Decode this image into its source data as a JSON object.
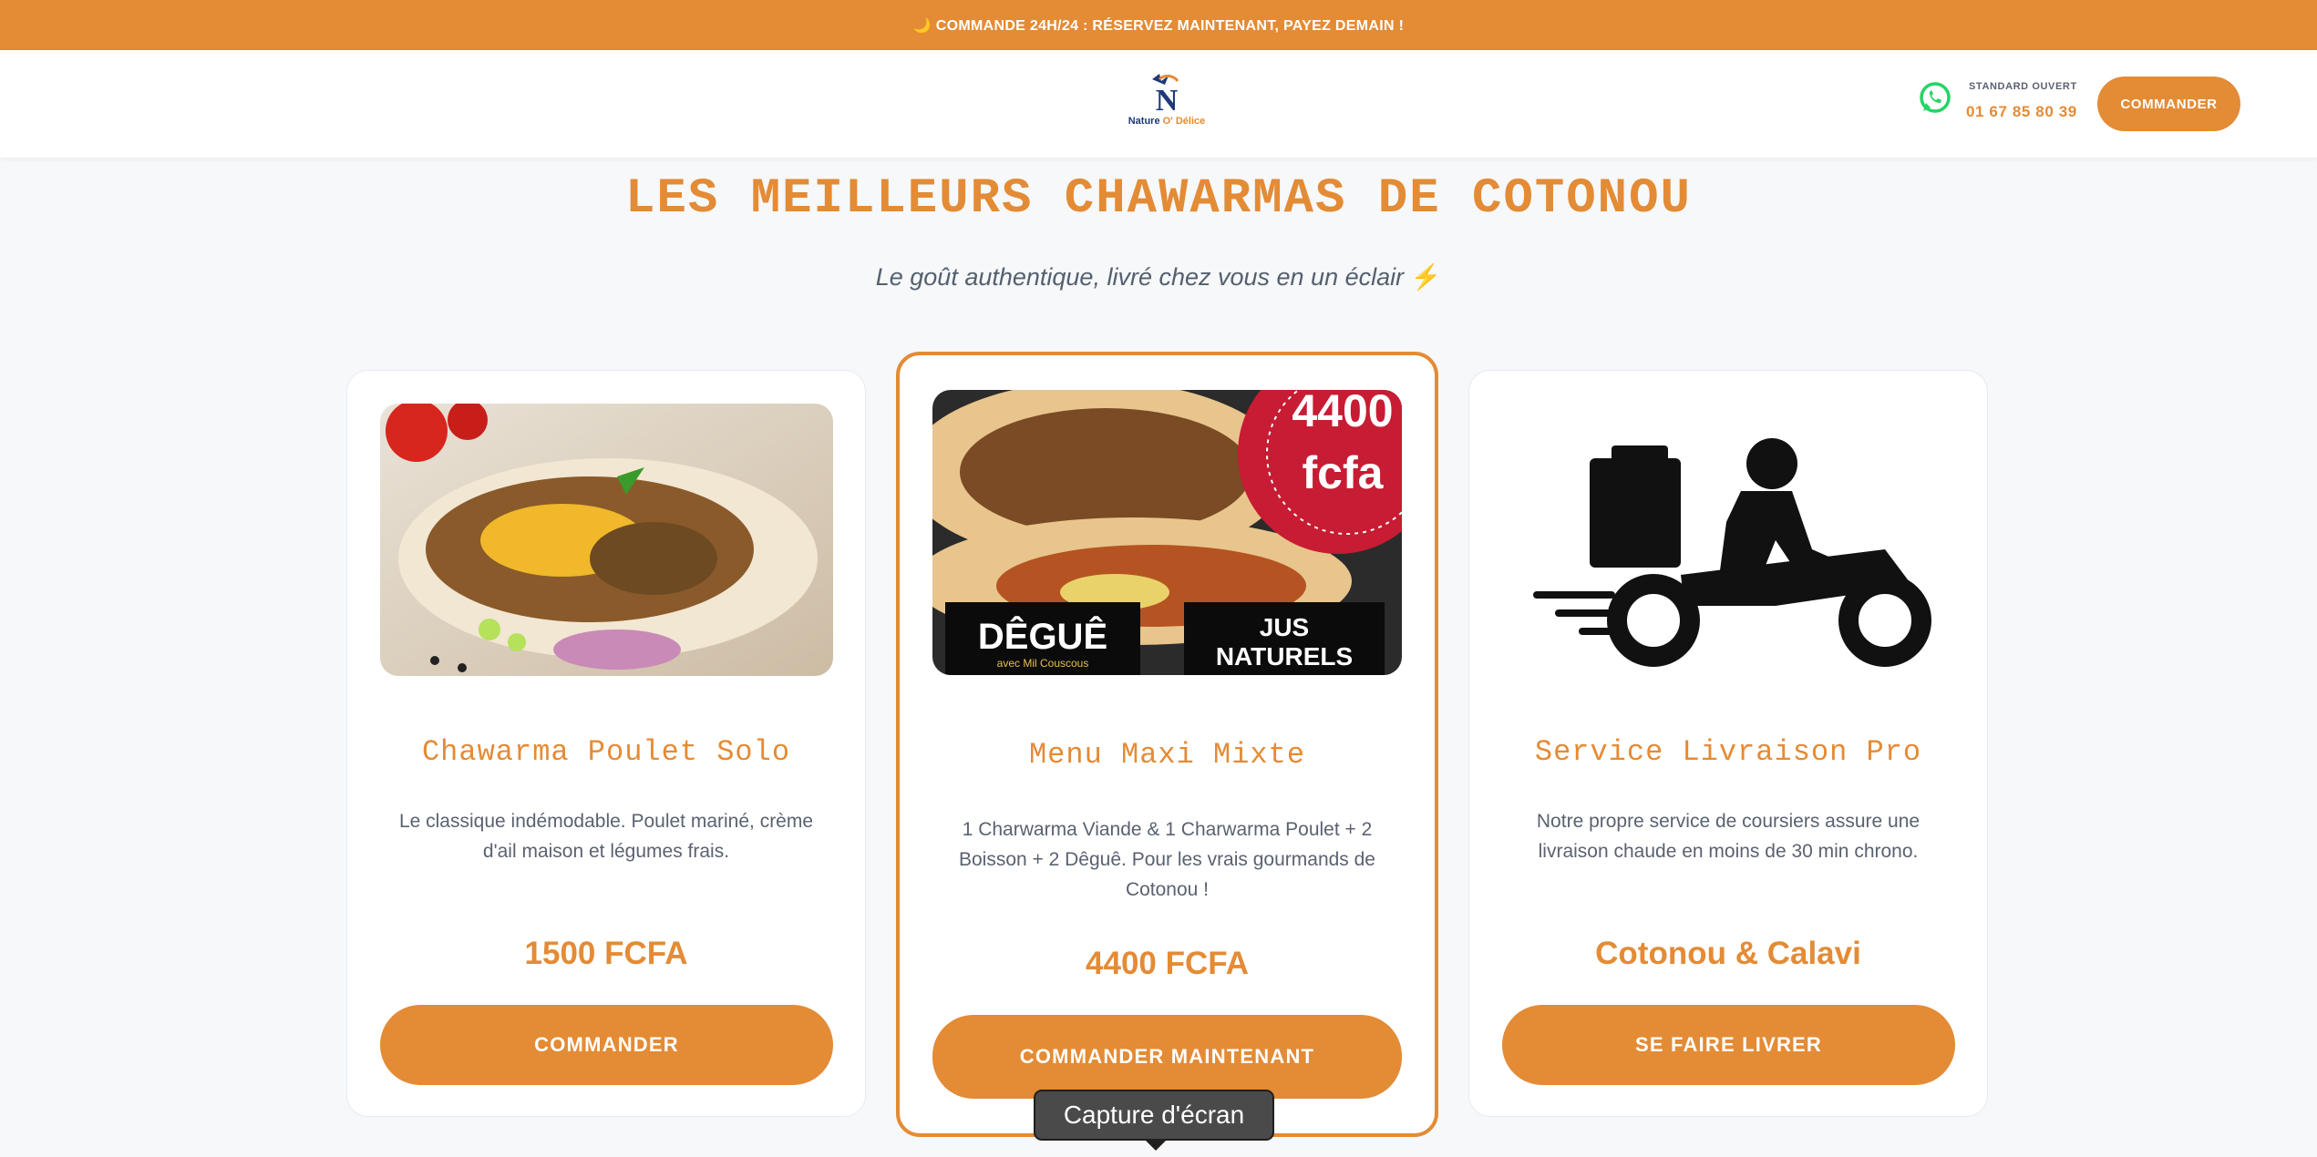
{
  "announcement": {
    "icon": "moon-icon",
    "text": "🌙 COMMANDE 24H/24 : RÉSERVEZ MAINTENANT, PAYEZ DEMAIN !"
  },
  "header": {
    "logo_text_a": "Nature ",
    "logo_text_b": "O' Délice",
    "standard_label": "STANDARD OUVERT",
    "phone": "01 67 85 80 39",
    "order_button": "COMMANDER",
    "whatsapp_icon": "whatsapp-icon"
  },
  "hero": {
    "title": "LES MEILLEURS CHAWARMAS DE COTONOU",
    "subtitle": "Le goût authentique, livré chez vous en un éclair",
    "subtitle_icon": "⚡"
  },
  "cards": [
    {
      "title": "Chawarma Poulet Solo",
      "description": "Le classique indémodable. Poulet mariné, crème d'ail maison et légumes frais.",
      "price": "1500 FCFA",
      "button": "COMMANDER"
    },
    {
      "title": "Menu Maxi Mixte",
      "description": "1 Charwarma Viande & 1 Charwarma Poulet + 2 Boisson + 2 Dêguê. Pour les vrais gourmands de Cotonou !",
      "price": "4400 FCFA",
      "button": "COMMANDER MAINTENANT",
      "badge_line1": "4400",
      "badge_line2": "fcfa",
      "tag_left": "DÊGUÊ",
      "tag_left_sub": "avec Mil Couscous",
      "tag_right_1": "JUS",
      "tag_right_2": "NATURELS"
    },
    {
      "title": "Service Livraison Pro",
      "description": "Notre propre service de coursiers assure une livraison chaude en moins de 30 min chrono.",
      "price": "Cotonou & Calavi",
      "button": "SE FAIRE LIVRER"
    }
  ],
  "tooltip": "Capture d'écran",
  "colors": {
    "accent": "#e48b35",
    "text": "#5a6270",
    "background": "#f6f8fa"
  }
}
